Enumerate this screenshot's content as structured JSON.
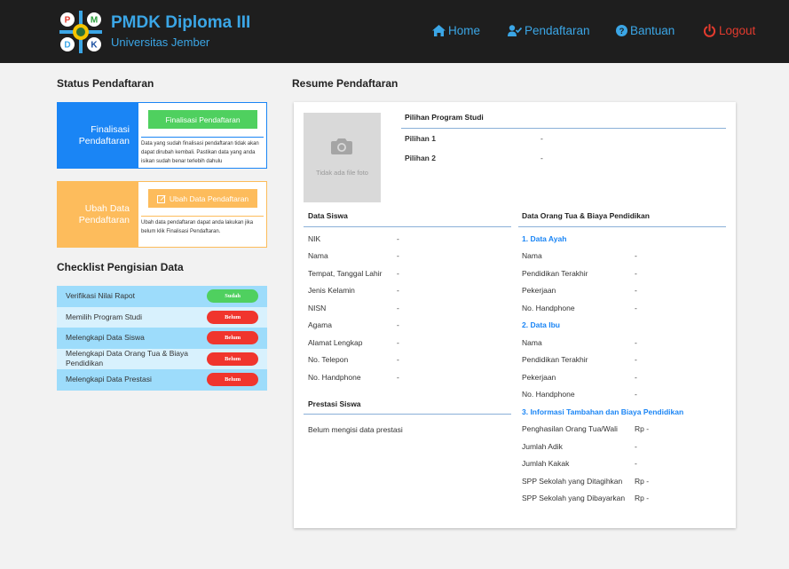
{
  "header": {
    "logo_letters": [
      "P",
      "M",
      "D",
      "K"
    ],
    "title": "PMDK Diploma III",
    "subtitle": "Universitas Jember",
    "nav": {
      "home": "Home",
      "pendaftaran": "Pendaftaran",
      "bantuan": "Bantuan",
      "logout": "Logout"
    }
  },
  "status": {
    "heading": "Status Pendaftaran",
    "finalisasi": {
      "label": "Finalisasi Pendaftaran",
      "button": "Finalisasi Pendaftaran",
      "note": "Data yang sudah finalisasi pendaftaran tidak akan dapat dirubah kembali. Pastikan data yang anda isikan sudah benar terlebih dahulu"
    },
    "ubah": {
      "label": "Ubah Data Pendaftaran",
      "button": "Ubah Data Pendaftaran",
      "note": "Ubah data pendaftaran dapat anda lakukan jika belum klik Finalisasi Pendaftaran."
    }
  },
  "checklist": {
    "heading": "Checklist Pengisian Data",
    "items": [
      {
        "label": "Verifikasi Nilai Rapot",
        "status": "Sudah"
      },
      {
        "label": "Memilih Program Studi",
        "status": "Belum"
      },
      {
        "label": "Melengkapi Data Siswa",
        "status": "Belum"
      },
      {
        "label": "Melengkapi Data Orang Tua & Biaya Pendidikan",
        "status": "Belum"
      },
      {
        "label": "Melengkapi Data Prestasi",
        "status": "Belum"
      }
    ]
  },
  "resume": {
    "heading": "Resume Pendaftaran",
    "photo_placeholder": "Tidak ada file foto",
    "prodi": {
      "heading": "Pilihan Program Studi",
      "rows": [
        {
          "label": "Pilihan 1",
          "value": "-"
        },
        {
          "label": "Pilihan 2",
          "value": "-"
        }
      ]
    },
    "siswa": {
      "heading": "Data Siswa",
      "rows": [
        {
          "label": "NIK",
          "value": "-"
        },
        {
          "label": "Nama",
          "value": "-"
        },
        {
          "label": "Tempat, Tanggal Lahir",
          "value": "-"
        },
        {
          "label": "Jenis Kelamin",
          "value": "-"
        },
        {
          "label": "NISN",
          "value": "-"
        },
        {
          "label": "Agama",
          "value": "-"
        },
        {
          "label": "Alamat Lengkap",
          "value": "-"
        },
        {
          "label": "No. Telepon",
          "value": "-"
        },
        {
          "label": "No. Handphone",
          "value": "-"
        }
      ]
    },
    "prestasi": {
      "heading": "Prestasi Siswa",
      "empty": "Belum mengisi data prestasi"
    },
    "ortu": {
      "heading": "Data Orang Tua & Biaya Pendidikan",
      "ayah": {
        "heading": "1. Data Ayah",
        "rows": [
          {
            "label": "Nama",
            "value": "-"
          },
          {
            "label": "Pendidikan Terakhir",
            "value": "-"
          },
          {
            "label": "Pekerjaan",
            "value": "-"
          },
          {
            "label": "No. Handphone",
            "value": "-"
          }
        ]
      },
      "ibu": {
        "heading": "2. Data Ibu",
        "rows": [
          {
            "label": "Nama",
            "value": "-"
          },
          {
            "label": "Pendidikan Terakhir",
            "value": "-"
          },
          {
            "label": "Pekerjaan",
            "value": "-"
          },
          {
            "label": "No. Handphone",
            "value": "-"
          }
        ]
      },
      "tambahan": {
        "heading": "3. Informasi Tambahan dan Biaya Pendidikan",
        "rows": [
          {
            "label": "Penghasilan Orang Tua/Wali",
            "value": "Rp -"
          },
          {
            "label": "Jumlah Adik",
            "value": "-"
          },
          {
            "label": "Jumlah Kakak",
            "value": "-"
          },
          {
            "label": "SPP Sekolah yang Ditagihkan",
            "value": "Rp -"
          },
          {
            "label": "SPP Sekolah yang Dibayarkan",
            "value": "Rp -"
          }
        ]
      }
    }
  },
  "colors": {
    "brand": "#3ba6e6",
    "logout": "#e33b2e",
    "primary_blue": "#1a85f5",
    "orange": "#fdbc5c",
    "green": "#4fd05f",
    "red": "#f0352d"
  }
}
